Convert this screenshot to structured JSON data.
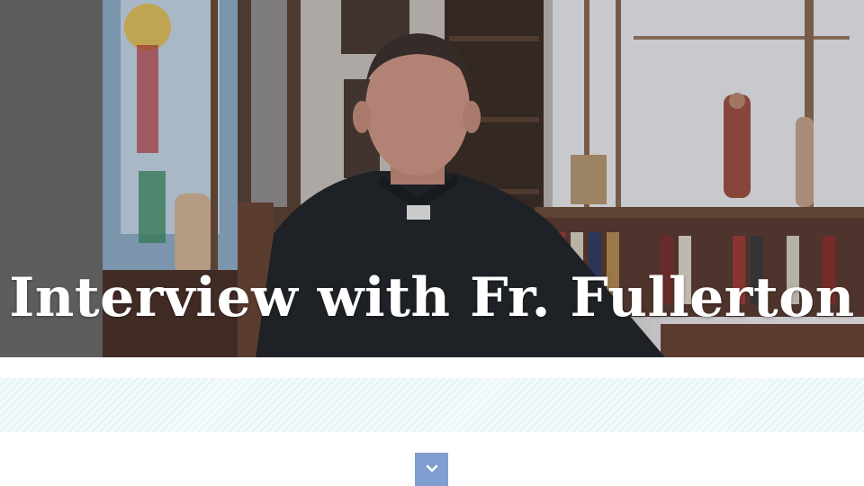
{
  "hero": {
    "title": "Interview with Fr. Fullerton",
    "background_image": "priest-interview-photo"
  },
  "scroll_button": {
    "icon": "chevron-down-icon",
    "color": "#7f9fd0"
  },
  "colors": {
    "sidebar_strip": "#5d5d5d",
    "pattern_band": "#f3fafb"
  }
}
